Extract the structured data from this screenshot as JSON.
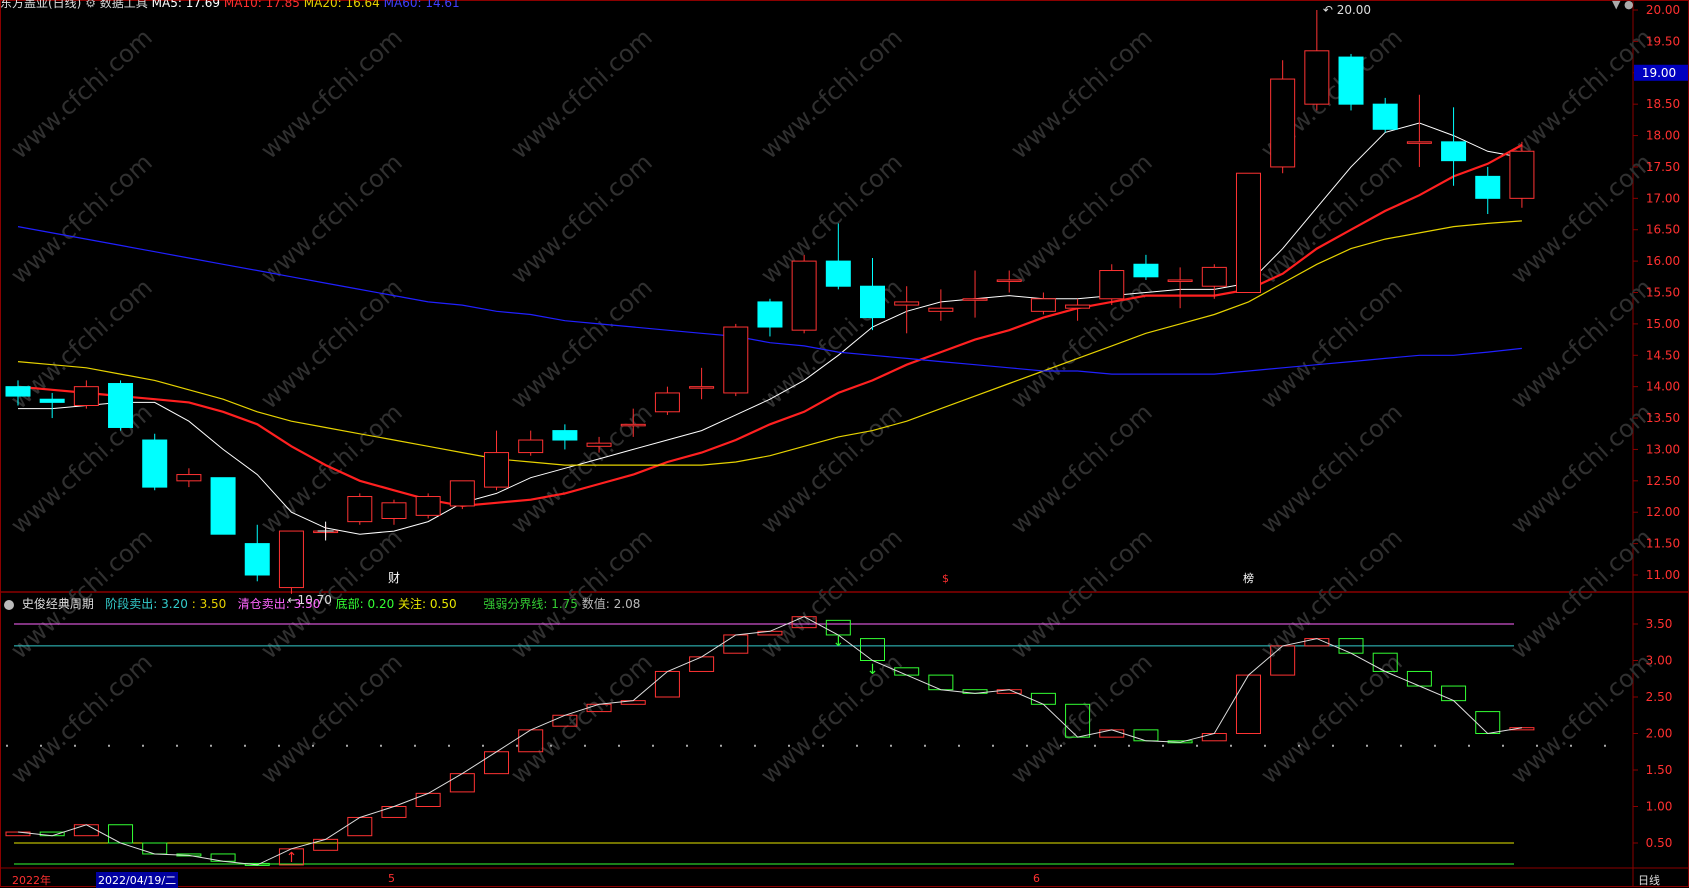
{
  "header": {
    "title": "东方盖亚(日线)",
    "label": "数据工具",
    "ma5": "MA5: 17.69",
    "ma10": "MA10: 17.85",
    "ma20": "MA20: 16.64",
    "ma60": "MA60: 14.61"
  },
  "indicator": {
    "name": "史俊经典周期",
    "stage_sell_label": "阶段卖出:",
    "stage_sell_a": "3.20",
    "stage_sell_b": "3.50",
    "clear_sell_label": "清仓卖出:",
    "clear_sell": "3.50",
    "bottom_label": "底部:",
    "bottom": "0.20",
    "focus_label": "关注:",
    "focus": "0.50",
    "strong_weak_label": "强弱分界线:",
    "strong_weak": "1.75",
    "value_label": "数值:",
    "value": "2.08"
  },
  "footer": {
    "year": "2022年",
    "date": "2022/04/19/二",
    "month5": "5",
    "month6": "6",
    "period": "日线"
  },
  "price_axis": {
    "ticks": [
      "20.00",
      "19.50",
      "19.00",
      "18.50",
      "18.00",
      "17.50",
      "17.00",
      "16.50",
      "16.00",
      "15.50",
      "15.00",
      "14.50",
      "14.00",
      "13.50",
      "13.00",
      "12.50",
      "12.00",
      "11.50",
      "11.00"
    ],
    "current": "19.00"
  },
  "ind_axis": {
    "ticks": [
      "3.50",
      "3.00",
      "2.50",
      "2.00",
      "1.50",
      "1.00",
      "0.50"
    ]
  },
  "markers": {
    "high": "20.00",
    "low": "10.70",
    "event1": "财",
    "event2": "$",
    "event3": "榜"
  },
  "watermark": "www.cfchi.com",
  "colors": {
    "up": "#ff3333",
    "down": "#00ffff",
    "ma5": "#ffffff",
    "ma10": "#ff2020",
    "ma20": "#e6d200",
    "ma60": "#2020ff",
    "ind_up": "#ff3333",
    "ind_down": "#33ff33",
    "line_sell_clear": "#ff66ff",
    "line_sell_stage": "#33cccc",
    "line_focus": "#e6e600",
    "line_bottom": "#33ff33"
  },
  "chart_data": [
    {
      "type": "candlestick",
      "title": "东方盖亚(日线)",
      "ylim": [
        10.5,
        20.2
      ],
      "candles": [
        {
          "o": 14.0,
          "h": 14.1,
          "l": 13.7,
          "c": 13.85
        },
        {
          "o": 13.8,
          "h": 13.9,
          "l": 13.5,
          "c": 13.75
        },
        {
          "o": 13.7,
          "h": 14.1,
          "l": 13.65,
          "c": 14.0
        },
        {
          "o": 14.05,
          "h": 14.1,
          "l": 13.3,
          "c": 13.35
        },
        {
          "o": 13.15,
          "h": 13.25,
          "l": 12.35,
          "c": 12.4
        },
        {
          "o": 12.5,
          "h": 12.7,
          "l": 12.4,
          "c": 12.6
        },
        {
          "o": 12.55,
          "h": 12.55,
          "l": 11.65,
          "c": 11.65
        },
        {
          "o": 11.5,
          "h": 11.8,
          "l": 10.9,
          "c": 11.0
        },
        {
          "o": 10.8,
          "h": 11.7,
          "l": 10.7,
          "c": 11.7
        },
        {
          "o": 11.7,
          "h": 11.8,
          "l": 11.6,
          "c": 11.7
        },
        {
          "o": 11.85,
          "h": 12.3,
          "l": 11.8,
          "c": 12.25
        },
        {
          "o": 11.9,
          "h": 12.2,
          "l": 11.8,
          "c": 12.15
        },
        {
          "o": 11.95,
          "h": 12.3,
          "l": 11.9,
          "c": 12.25
        },
        {
          "o": 12.1,
          "h": 12.5,
          "l": 12.05,
          "c": 12.5
        },
        {
          "o": 12.4,
          "h": 13.3,
          "l": 12.35,
          "c": 12.95
        },
        {
          "o": 12.95,
          "h": 13.3,
          "l": 12.9,
          "c": 13.15
        },
        {
          "o": 13.3,
          "h": 13.4,
          "l": 13.0,
          "c": 13.15
        },
        {
          "o": 13.05,
          "h": 13.2,
          "l": 12.95,
          "c": 13.1
        },
        {
          "o": 13.4,
          "h": 13.65,
          "l": 13.2,
          "c": 13.4
        },
        {
          "o": 13.6,
          "h": 14.0,
          "l": 13.55,
          "c": 13.9
        },
        {
          "o": 14.0,
          "h": 14.3,
          "l": 13.8,
          "c": 14.0
        },
        {
          "o": 13.9,
          "h": 15.0,
          "l": 13.85,
          "c": 14.95
        },
        {
          "o": 15.35,
          "h": 15.4,
          "l": 14.8,
          "c": 14.95
        },
        {
          "o": 14.9,
          "h": 16.1,
          "l": 14.85,
          "c": 16.0
        },
        {
          "o": 16.0,
          "h": 16.6,
          "l": 15.55,
          "c": 15.6
        },
        {
          "o": 15.6,
          "h": 16.05,
          "l": 14.9,
          "c": 15.1
        },
        {
          "o": 15.3,
          "h": 15.6,
          "l": 14.85,
          "c": 15.35
        },
        {
          "o": 15.2,
          "h": 15.55,
          "l": 15.05,
          "c": 15.25
        },
        {
          "o": 15.4,
          "h": 15.85,
          "l": 15.1,
          "c": 15.4
        },
        {
          "o": 15.7,
          "h": 15.85,
          "l": 15.5,
          "c": 15.7
        },
        {
          "o": 15.2,
          "h": 15.5,
          "l": 15.15,
          "c": 15.4
        },
        {
          "o": 15.25,
          "h": 15.4,
          "l": 15.05,
          "c": 15.3
        },
        {
          "o": 15.4,
          "h": 15.95,
          "l": 15.3,
          "c": 15.85
        },
        {
          "o": 15.95,
          "h": 16.1,
          "l": 15.7,
          "c": 15.75
        },
        {
          "o": 15.7,
          "h": 15.9,
          "l": 15.25,
          "c": 15.7
        },
        {
          "o": 15.6,
          "h": 15.95,
          "l": 15.4,
          "c": 15.9
        },
        {
          "o": 15.5,
          "h": 17.4,
          "l": 15.5,
          "c": 17.4
        },
        {
          "o": 17.5,
          "h": 19.2,
          "l": 17.4,
          "c": 18.9
        },
        {
          "o": 18.5,
          "h": 20.0,
          "l": 18.4,
          "c": 19.35
        },
        {
          "o": 19.25,
          "h": 19.3,
          "l": 18.4,
          "c": 18.5
        },
        {
          "o": 18.5,
          "h": 18.6,
          "l": 18.05,
          "c": 18.1
        },
        {
          "o": 17.9,
          "h": 18.65,
          "l": 17.5,
          "c": 17.9
        },
        {
          "o": 17.9,
          "h": 18.45,
          "l": 17.2,
          "c": 17.6
        },
        {
          "o": 17.35,
          "h": 17.5,
          "l": 16.75,
          "c": 17.0
        },
        {
          "o": 17.0,
          "h": 17.9,
          "l": 16.85,
          "c": 17.75
        }
      ],
      "series": [
        {
          "name": "MA5",
          "values": [
            13.65,
            13.65,
            13.7,
            13.75,
            13.75,
            13.45,
            13.0,
            12.6,
            12.0,
            11.75,
            11.65,
            11.7,
            11.85,
            12.15,
            12.3,
            12.55,
            12.7,
            12.85,
            13.0,
            13.15,
            13.3,
            13.55,
            13.8,
            14.1,
            14.5,
            14.95,
            15.2,
            15.35,
            15.4,
            15.45,
            15.4,
            15.4,
            15.45,
            15.5,
            15.55,
            15.55,
            15.65,
            16.2,
            16.85,
            17.5,
            18.05,
            18.2,
            18.0,
            17.75,
            17.65
          ]
        },
        {
          "name": "MA10",
          "values": [
            14.0,
            13.95,
            13.9,
            13.85,
            13.8,
            13.75,
            13.6,
            13.4,
            13.05,
            12.75,
            12.5,
            12.35,
            12.2,
            12.1,
            12.15,
            12.2,
            12.3,
            12.45,
            12.6,
            12.8,
            12.95,
            13.15,
            13.4,
            13.6,
            13.9,
            14.1,
            14.35,
            14.55,
            14.75,
            14.9,
            15.1,
            15.25,
            15.35,
            15.45,
            15.45,
            15.45,
            15.55,
            15.8,
            16.2,
            16.5,
            16.8,
            17.05,
            17.35,
            17.55,
            17.85
          ]
        },
        {
          "name": "MA20",
          "values": [
            14.4,
            14.35,
            14.3,
            14.2,
            14.1,
            13.95,
            13.8,
            13.6,
            13.45,
            13.35,
            13.25,
            13.15,
            13.05,
            12.95,
            12.85,
            12.8,
            12.75,
            12.75,
            12.75,
            12.75,
            12.75,
            12.8,
            12.9,
            13.05,
            13.2,
            13.3,
            13.45,
            13.65,
            13.85,
            14.05,
            14.25,
            14.45,
            14.65,
            14.85,
            15.0,
            15.15,
            15.35,
            15.65,
            15.95,
            16.2,
            16.35,
            16.45,
            16.55,
            16.6,
            16.64
          ]
        },
        {
          "name": "MA60",
          "values": [
            16.55,
            16.45,
            16.35,
            16.25,
            16.15,
            16.05,
            15.95,
            15.85,
            15.75,
            15.65,
            15.55,
            15.45,
            15.35,
            15.3,
            15.2,
            15.15,
            15.05,
            15.0,
            14.95,
            14.9,
            14.85,
            14.8,
            14.7,
            14.65,
            14.55,
            14.5,
            14.45,
            14.4,
            14.35,
            14.3,
            14.25,
            14.25,
            14.2,
            14.2,
            14.2,
            14.2,
            14.25,
            14.3,
            14.35,
            14.4,
            14.45,
            14.5,
            14.5,
            14.55,
            14.61
          ]
        }
      ]
    },
    {
      "type": "bar",
      "title": "史俊经典周期",
      "ylim": [
        0.0,
        3.75
      ],
      "levels": [
        {
          "name": "清仓卖出",
          "value": 3.5
        },
        {
          "name": "阶段卖出",
          "value": 3.2
        },
        {
          "name": "关注",
          "value": 0.5
        },
        {
          "name": "底部",
          "value": 0.2
        }
      ],
      "bars": [
        {
          "o": 0.6,
          "c": 0.65
        },
        {
          "o": 0.65,
          "c": 0.6
        },
        {
          "o": 0.6,
          "c": 0.75
        },
        {
          "o": 0.75,
          "c": 0.5
        },
        {
          "o": 0.5,
          "c": 0.35
        },
        {
          "o": 0.35,
          "c": 0.33
        },
        {
          "o": 0.35,
          "c": 0.25
        },
        {
          "o": 0.22,
          "c": 0.2
        },
        {
          "o": 0.2,
          "c": 0.42
        },
        {
          "o": 0.4,
          "c": 0.55
        },
        {
          "o": 0.6,
          "c": 0.85
        },
        {
          "o": 0.85,
          "c": 1.0
        },
        {
          "o": 1.0,
          "c": 1.18
        },
        {
          "o": 1.2,
          "c": 1.45
        },
        {
          "o": 1.45,
          "c": 1.75
        },
        {
          "o": 1.75,
          "c": 2.05
        },
        {
          "o": 2.1,
          "c": 2.25
        },
        {
          "o": 2.3,
          "c": 2.4
        },
        {
          "o": 2.4,
          "c": 2.45
        },
        {
          "o": 2.5,
          "c": 2.85
        },
        {
          "o": 2.85,
          "c": 3.05
        },
        {
          "o": 3.1,
          "c": 3.35
        },
        {
          "o": 3.35,
          "c": 3.4
        },
        {
          "o": 3.45,
          "c": 3.6
        },
        {
          "o": 3.55,
          "c": 3.35
        },
        {
          "o": 3.3,
          "c": 3.0
        },
        {
          "o": 2.9,
          "c": 2.8
        },
        {
          "o": 2.8,
          "c": 2.6
        },
        {
          "o": 2.6,
          "c": 2.55
        },
        {
          "o": 2.55,
          "c": 2.6
        },
        {
          "o": 2.55,
          "c": 2.4
        },
        {
          "o": 2.4,
          "c": 1.95
        },
        {
          "o": 1.95,
          "c": 2.05
        },
        {
          "o": 2.05,
          "c": 1.9
        },
        {
          "o": 1.9,
          "c": 1.88
        },
        {
          "o": 1.9,
          "c": 2.0
        },
        {
          "o": 2.0,
          "c": 2.8
        },
        {
          "o": 2.8,
          "c": 3.2
        },
        {
          "o": 3.2,
          "c": 3.3
        },
        {
          "o": 3.3,
          "c": 3.1
        },
        {
          "o": 3.1,
          "c": 2.85
        },
        {
          "o": 2.85,
          "c": 2.65
        },
        {
          "o": 2.65,
          "c": 2.45
        },
        {
          "o": 2.3,
          "c": 2.0
        },
        {
          "o": 2.05,
          "c": 2.08
        }
      ]
    }
  ]
}
